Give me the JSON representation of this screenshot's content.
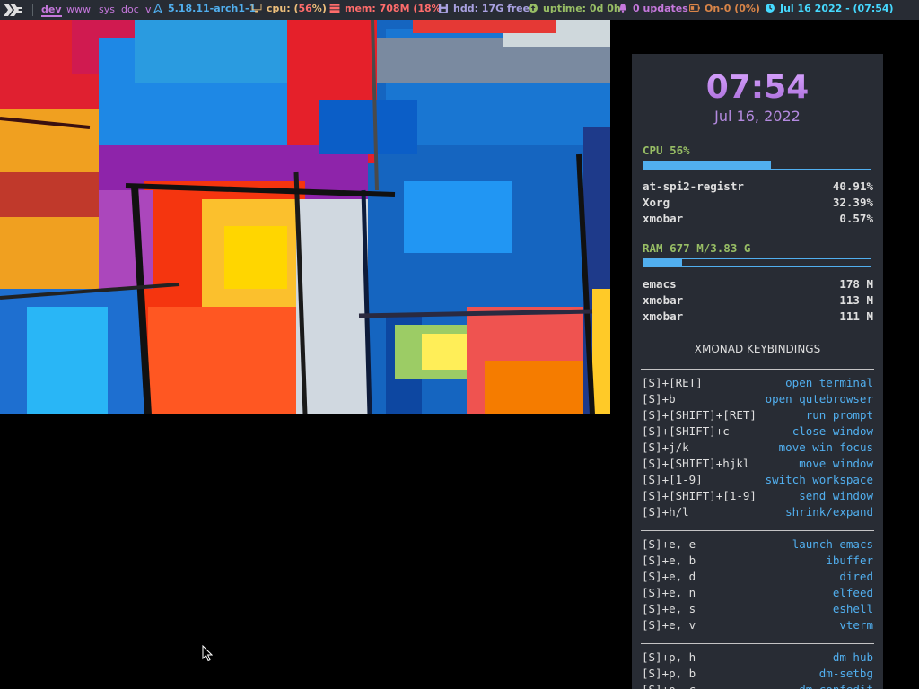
{
  "topbar": {
    "workspaces": [
      "dev",
      "www",
      "sys",
      "doc",
      "v"
    ],
    "active_workspace": "dev",
    "kernel": "5.18.11-arch1-1",
    "cpu_prefix": "cpu: (",
    "cpu_value": "56",
    "cpu_suffix": "%)",
    "mem": "mem: 708M (18%)",
    "hdd": "hdd: 17G free",
    "uptime": "uptime: 0d 0h",
    "updates": "0 updates",
    "battery": "On-0 (0%)",
    "datetime": "Jul 16 2022 - (07:54)",
    "colors": {
      "kernel": "#51afef",
      "cpu": "#ecbe7b",
      "mem": "#ff6c6b",
      "hdd": "#a9a1e1",
      "uptime": "#98be65",
      "updates": "#c678dd",
      "battery": "#da8548",
      "datetime": "#46d9ff"
    }
  },
  "conky": {
    "time": "07:54",
    "date": "Jul 16, 2022",
    "cpu": {
      "label": "CPU  56%",
      "usage": 0.56,
      "processes": [
        {
          "name": "at-spi2-registr",
          "value": "40.91%"
        },
        {
          "name": "Xorg",
          "value": "32.39%"
        },
        {
          "name": "xmobar",
          "value": "0.57%"
        }
      ]
    },
    "ram": {
      "label": "RAM  677 M/3.83 G",
      "usage": 0.17,
      "processes": [
        {
          "name": "emacs",
          "value": "178 M"
        },
        {
          "name": "xmobar",
          "value": "113 M"
        },
        {
          "name": "xmobar",
          "value": "111 M"
        }
      ]
    },
    "keybindings_title": "XMONAD KEYBINDINGS",
    "keybindings": [
      [
        {
          "key": "[S]+[RET]",
          "action": "open terminal"
        },
        {
          "key": "[S]+b",
          "action": "open qutebrowser"
        },
        {
          "key": "[S]+[SHIFT]+[RET]",
          "action": "run prompt"
        },
        {
          "key": "[S]+[SHIFT]+c",
          "action": "close window"
        },
        {
          "key": "[S]+j/k",
          "action": "move win focus"
        },
        {
          "key": "[S]+[SHIFT]+hjkl",
          "action": "move window"
        },
        {
          "key": "[S]+[1-9]",
          "action": "switch workspace"
        },
        {
          "key": "[S]+[SHIFT]+[1-9]",
          "action": "send window"
        },
        {
          "key": "[S]+h/l",
          "action": "shrink/expand"
        }
      ],
      [
        {
          "key": "[S]+e, e",
          "action": "launch emacs"
        },
        {
          "key": "[S]+e, b",
          "action": "ibuffer"
        },
        {
          "key": "[S]+e, d",
          "action": "dired"
        },
        {
          "key": "[S]+e, n",
          "action": "elfeed"
        },
        {
          "key": "[S]+e, s",
          "action": "eshell"
        },
        {
          "key": "[S]+e, v",
          "action": "vterm"
        }
      ],
      [
        {
          "key": "[S]+p, h",
          "action": "dm-hub"
        },
        {
          "key": "[S]+p, b",
          "action": "dm-setbg"
        },
        {
          "key": "[S]+p, c",
          "action": "dm-confedit"
        }
      ]
    ]
  }
}
